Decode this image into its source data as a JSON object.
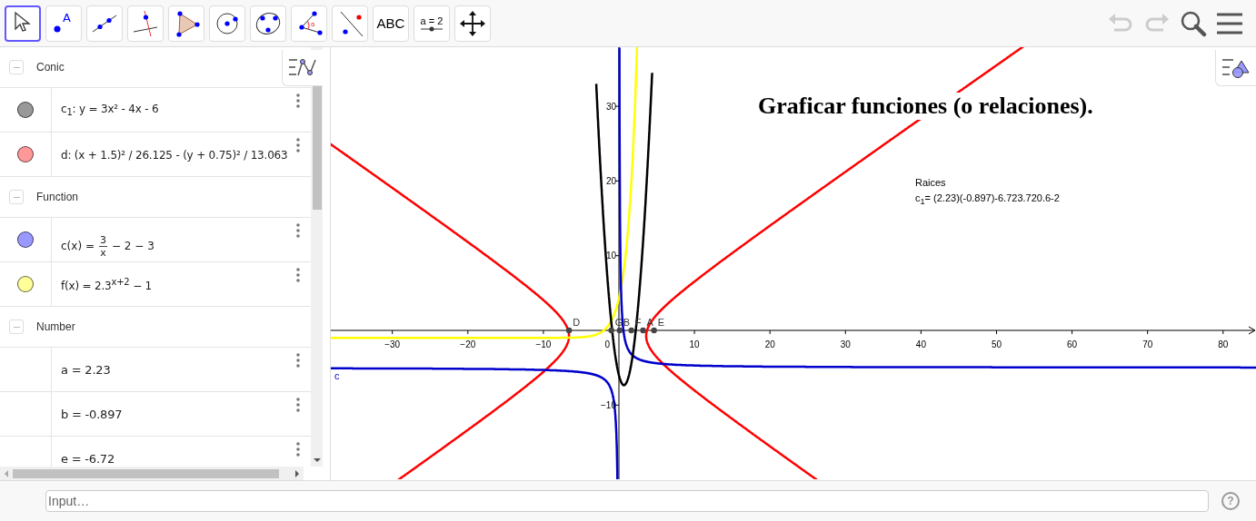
{
  "toolbar": {
    "tools": [
      {
        "kind": "move",
        "selected": true
      },
      {
        "kind": "point",
        "icon_text": "A",
        "selected": false
      },
      {
        "kind": "line",
        "selected": false
      },
      {
        "kind": "perpendicular",
        "selected": false
      },
      {
        "kind": "polygon",
        "selected": false
      },
      {
        "kind": "circle",
        "selected": false
      },
      {
        "kind": "conic",
        "selected": false
      },
      {
        "kind": "angle",
        "icon_text": "α",
        "selected": false
      },
      {
        "kind": "reflect",
        "selected": false
      },
      {
        "kind": "text",
        "label": "ABC",
        "selected": false
      },
      {
        "kind": "slider",
        "label": "a = 2",
        "selected": false
      },
      {
        "kind": "pan",
        "selected": false
      }
    ],
    "undo": {
      "disabled": true
    },
    "redo": {
      "disabled": true
    }
  },
  "algebra": {
    "groups": [
      {
        "title": "Conic",
        "expanded": true,
        "items": [
          {
            "kind": "text",
            "formula": "c$_{1}$: y = 3x² - 4x - 6",
            "color": "#999999"
          },
          {
            "kind": "text",
            "formula": "d: (x + 1.5)² / 26.125 - (y + 0.75)² / 13.063",
            "color": "#ff9999"
          }
        ]
      },
      {
        "title": "Function",
        "expanded": true,
        "items": [
          {
            "kind": "fraction",
            "prefix": "c(x) =",
            "numerator": "3",
            "denominator": "x",
            "suffix": "− 2 − 3",
            "color": "#9999ff"
          },
          {
            "kind": "text",
            "formula": "f(x) = 2.3$^{x+2}$ − 1",
            "color": "#ffff99"
          }
        ]
      },
      {
        "title": "Number",
        "expanded": true,
        "items": [
          {
            "kind": "text",
            "formula": "a = 2.23"
          },
          {
            "kind": "text",
            "formula": "b = -0.897"
          },
          {
            "kind": "text",
            "formula": "e = -6.72"
          }
        ]
      }
    ]
  },
  "graphics": {
    "title": "Graficar funciones (o relaciones).",
    "note_title": "Raices",
    "note": "c$_{1}$= (2.23)(-0.897)-6.723.720.6-2",
    "x_ticks": [
      "−30",
      "−20",
      "−10",
      "10",
      "20",
      "30",
      "40",
      "50",
      "60",
      "70",
      "80"
    ],
    "y_ticks": [
      "30",
      "20",
      "10",
      "−10"
    ],
    "origin_label": "0",
    "curve_label": "c",
    "points": [
      {
        "label": "D"
      },
      {
        "label": "G"
      },
      {
        "label": "B"
      },
      {
        "label": "F"
      },
      {
        "label": "A"
      },
      {
        "label": "E"
      }
    ]
  },
  "input_bar": {
    "placeholder": "Input…",
    "help": "?"
  }
}
